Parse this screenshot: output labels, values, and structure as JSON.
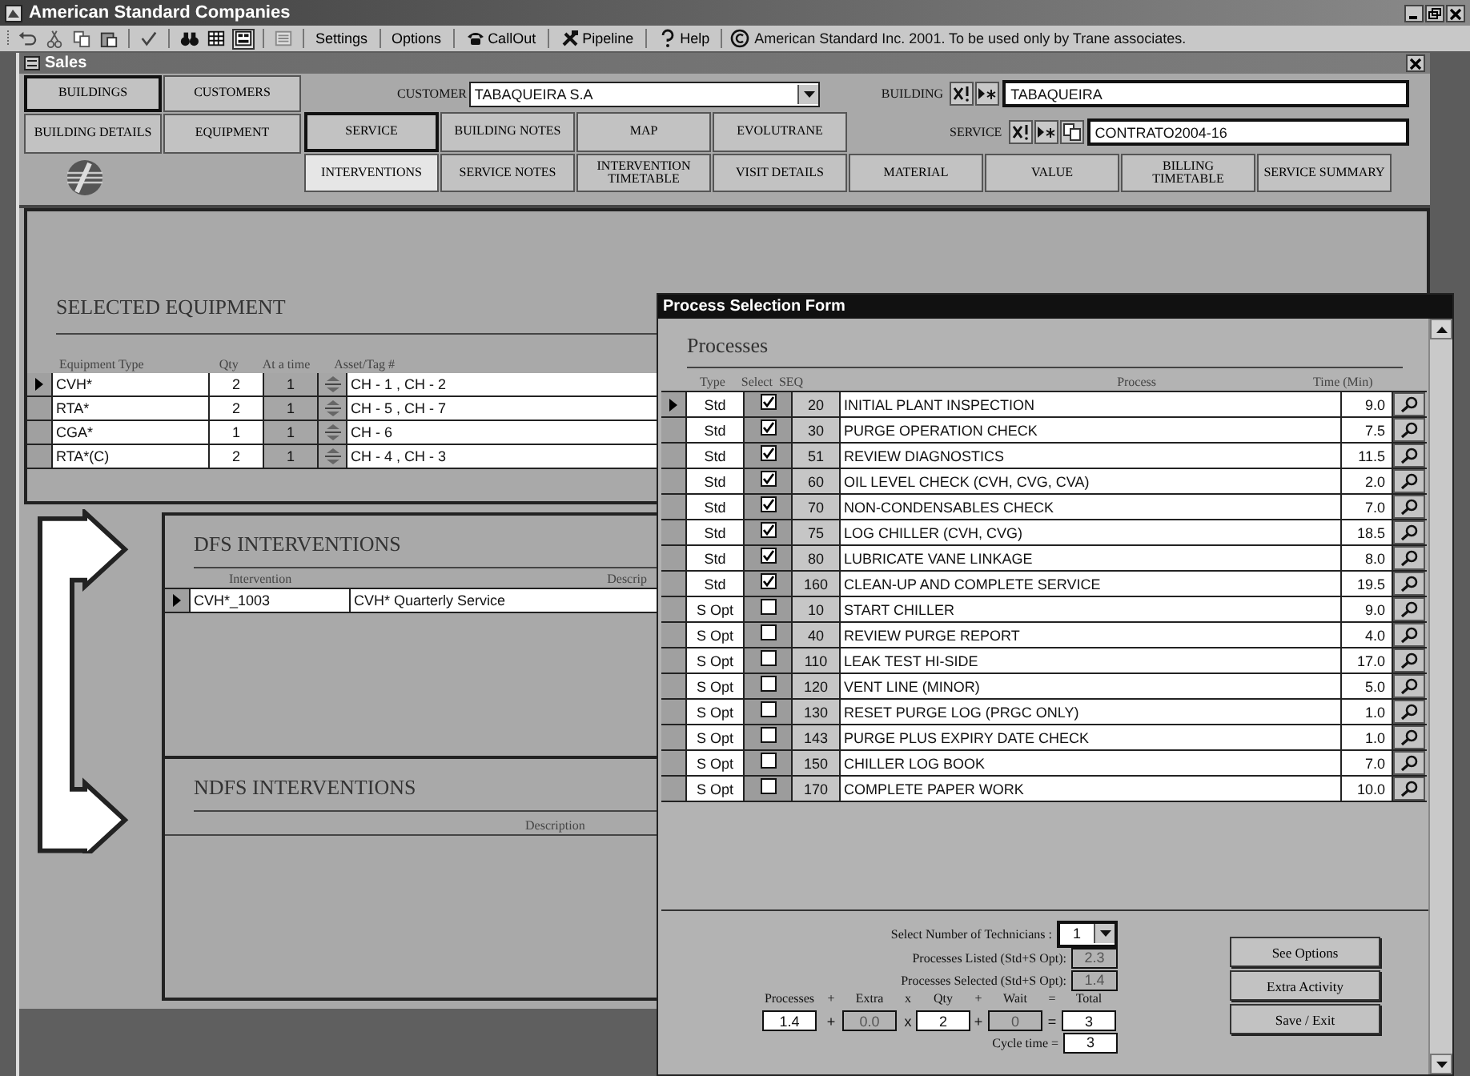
{
  "app": {
    "title": "American Standard Companies"
  },
  "toolbar": {
    "buttons": [
      {
        "label": "Settings"
      },
      {
        "label": "Options"
      },
      {
        "label": "CallOut"
      },
      {
        "label": "Pipeline"
      },
      {
        "label": "Help"
      }
    ],
    "notice": "American Standard Inc. 2001. To be used only by Trane associates."
  },
  "sales": {
    "title": "Sales",
    "nav": [
      {
        "label": "BUILDINGS",
        "selected": true
      },
      {
        "label": "CUSTOMERS",
        "selected": false
      },
      {
        "label": "BUILDING DETAILS",
        "selected": false
      },
      {
        "label": "EQUIPMENT",
        "selected": false
      }
    ],
    "customer": {
      "label": "CUSTOMER",
      "value": "TABAQUEIRA S.A"
    },
    "building": {
      "label": "BUILDING",
      "value": "TABAQUEIRA"
    },
    "service": {
      "label": "SERVICE",
      "value": "CONTRATO2004-16"
    },
    "tabs": [
      {
        "label": "SERVICE",
        "selected": true
      },
      {
        "label": "BUILDING NOTES",
        "selected": false
      },
      {
        "label": "MAP",
        "selected": false
      },
      {
        "label": "EVOLUTRANE",
        "selected": false
      }
    ],
    "subtabs": [
      {
        "label": "INTERVENTIONS",
        "selected": true
      },
      {
        "label": "SERVICE NOTES",
        "selected": false
      },
      {
        "label": "INTERVENTION TIMETABLE",
        "selected": false
      },
      {
        "label": "VISIT DETAILS",
        "selected": false
      },
      {
        "label": "MATERIAL",
        "selected": false
      },
      {
        "label": "VALUE",
        "selected": false
      },
      {
        "label": "BILLING TIMETABLE",
        "selected": false
      },
      {
        "label": "SERVICE SUMMARY",
        "selected": false
      }
    ],
    "equipment": {
      "title": "SELECTED EQUIPMENT",
      "columns": [
        "Equipment Type",
        "Qty",
        "At a time",
        "Asset/Tag #"
      ],
      "rows": [
        {
          "type": "CVH*",
          "qty": "2",
          "at_a_time": "1",
          "assets": "CH - 1 , CH - 2",
          "selected": true
        },
        {
          "type": "RTA*",
          "qty": "2",
          "at_a_time": "1",
          "assets": "CH - 5 , CH - 7",
          "selected": false
        },
        {
          "type": "CGA*",
          "qty": "1",
          "at_a_time": "1",
          "assets": "CH - 6",
          "selected": false
        },
        {
          "type": "RTA*(C)",
          "qty": "2",
          "at_a_time": "1",
          "assets": "CH - 4 , CH - 3",
          "selected": false
        }
      ]
    },
    "dfs": {
      "title": "DFS INTERVENTIONS",
      "columns": [
        "Intervention",
        "Descrip"
      ],
      "rows": [
        {
          "intervention": "CVH*_1003",
          "description": "CVH* Quarterly Service",
          "selected": true
        }
      ]
    },
    "ndfs": {
      "title": "NDFS INTERVENTIONS",
      "columns": [
        "Description"
      ]
    }
  },
  "process_form": {
    "title": "Process Selection Form",
    "heading": "Processes",
    "columns": [
      "Type",
      "Select",
      "SEQ",
      "Process",
      "Time (Min)"
    ],
    "rows": [
      {
        "type": "Std",
        "checked": true,
        "seq": "20",
        "process": "INITIAL PLANT INSPECTION",
        "time": "9.0",
        "selected": true
      },
      {
        "type": "Std",
        "checked": true,
        "seq": "30",
        "process": "PURGE OPERATION CHECK",
        "time": "7.5",
        "selected": false
      },
      {
        "type": "Std",
        "checked": true,
        "seq": "51",
        "process": "REVIEW DIAGNOSTICS",
        "time": "11.5",
        "selected": false
      },
      {
        "type": "Std",
        "checked": true,
        "seq": "60",
        "process": "OIL LEVEL CHECK (CVH, CVG, CVA)",
        "time": "2.0",
        "selected": false
      },
      {
        "type": "Std",
        "checked": true,
        "seq": "70",
        "process": "NON-CONDENSABLES CHECK",
        "time": "7.0",
        "selected": false
      },
      {
        "type": "Std",
        "checked": true,
        "seq": "75",
        "process": "LOG CHILLER (CVH, CVG)",
        "time": "18.5",
        "selected": false
      },
      {
        "type": "Std",
        "checked": true,
        "seq": "80",
        "process": "LUBRICATE VANE LINKAGE",
        "time": "8.0",
        "selected": false
      },
      {
        "type": "Std",
        "checked": true,
        "seq": "160",
        "process": "CLEAN-UP AND COMPLETE SERVICE",
        "time": "19.5",
        "selected": false
      },
      {
        "type": "S Opt",
        "checked": false,
        "seq": "10",
        "process": "START CHILLER",
        "time": "9.0",
        "selected": false
      },
      {
        "type": "S Opt",
        "checked": false,
        "seq": "40",
        "process": "REVIEW PURGE REPORT",
        "time": "4.0",
        "selected": false
      },
      {
        "type": "S Opt",
        "checked": false,
        "seq": "110",
        "process": "LEAK TEST HI-SIDE",
        "time": "17.0",
        "selected": false
      },
      {
        "type": "S Opt",
        "checked": false,
        "seq": "120",
        "process": "VENT LINE (MINOR)",
        "time": "5.0",
        "selected": false
      },
      {
        "type": "S Opt",
        "checked": false,
        "seq": "130",
        "process": "RESET PURGE LOG (PRGC ONLY)",
        "time": "1.0",
        "selected": false
      },
      {
        "type": "S Opt",
        "checked": false,
        "seq": "143",
        "process": "PURGE PLUS EXPIRY DATE CHECK",
        "time": "1.0",
        "selected": false
      },
      {
        "type": "S Opt",
        "checked": false,
        "seq": "150",
        "process": "CHILLER LOG BOOK",
        "time": "7.0",
        "selected": false
      },
      {
        "type": "S Opt",
        "checked": false,
        "seq": "170",
        "process": "COMPLETE PAPER WORK",
        "time": "10.0",
        "selected": false
      }
    ],
    "technicians": {
      "label": "Select Number of Technicians :",
      "value": "1"
    },
    "listed": {
      "label": "Processes Listed (Std+S Opt):",
      "value": "2.3",
      "disabled": true
    },
    "selected_count": {
      "label": "Processes Selected (Std+S Opt):",
      "value": "1.4",
      "disabled": true
    },
    "formula": {
      "labels": [
        "Processes",
        "+",
        "Extra",
        "x",
        "Qty",
        "+",
        "Wait",
        "=",
        "Total"
      ],
      "terms": [
        {
          "kind": "field",
          "value": "1.4",
          "disabled": false
        },
        {
          "kind": "operator",
          "value": "+"
        },
        {
          "kind": "field",
          "value": "0.0",
          "disabled": true
        },
        {
          "kind": "operator",
          "value": "x"
        },
        {
          "kind": "field",
          "value": "2",
          "disabled": false
        },
        {
          "kind": "operator",
          "value": "+"
        },
        {
          "kind": "field",
          "value": "0",
          "disabled": true
        },
        {
          "kind": "operator",
          "value": "="
        },
        {
          "kind": "field",
          "value": "3",
          "disabled": false
        }
      ]
    },
    "cycle_time": {
      "label": "Cycle time =",
      "value": "3"
    },
    "buttons": [
      "See Options",
      "Extra Activity",
      "Save / Exit"
    ]
  }
}
